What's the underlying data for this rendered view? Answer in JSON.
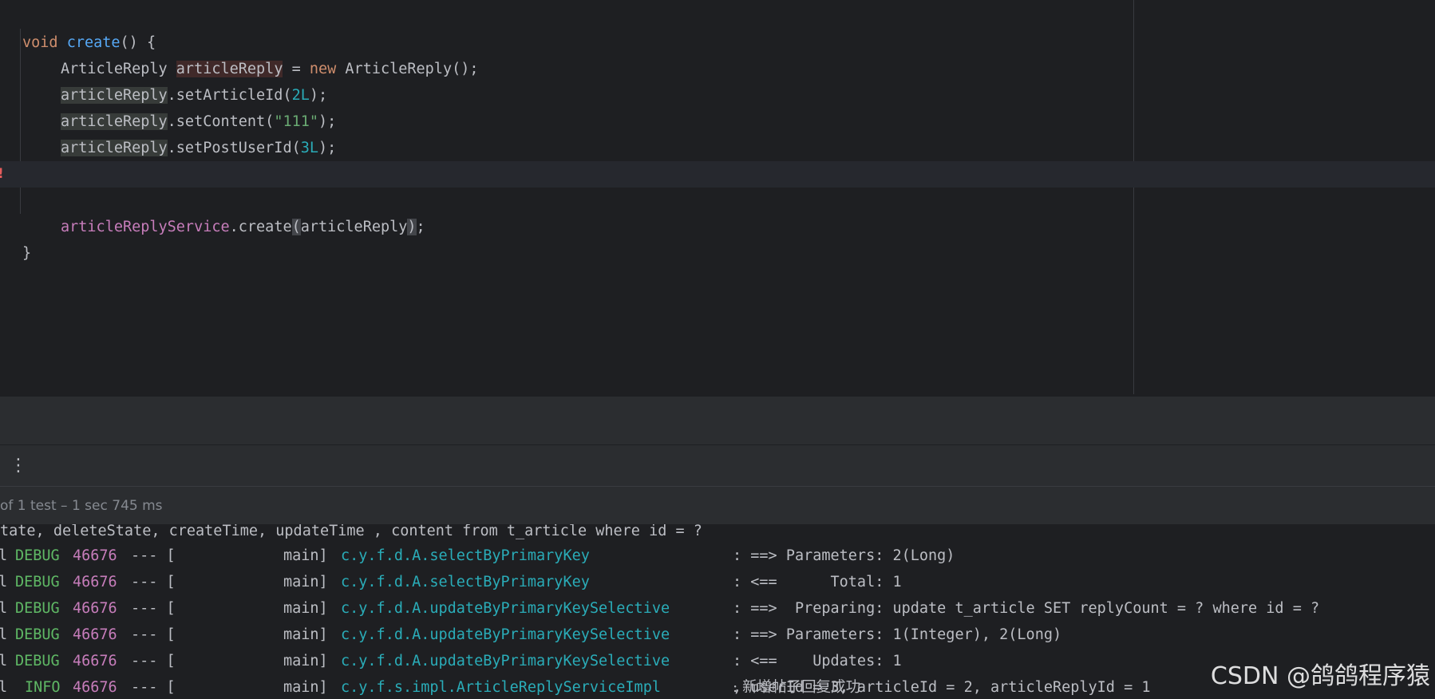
{
  "editor": {
    "lines": {
      "l0": {
        "kw_void": "void",
        "method_name": "create",
        "tail": "() {"
      },
      "l1": {
        "type": "ArticleReply",
        "var": "articleReply",
        "eq": " = ",
        "kw_new": "new",
        "ctor": " ArticleReply();"
      },
      "l2": {
        "var": "articleReply",
        "call": ".setArticleId(",
        "arg": "2L",
        "end": ");"
      },
      "l3": {
        "var": "articleReply",
        "call": ".setContent(",
        "arg": "\"111\"",
        "end": ");"
      },
      "l4": {
        "var": "articleReply",
        "call": ".setPostUserId(",
        "arg": "3L",
        "end": ");"
      },
      "l5": {
        "field": "articleReplyService",
        "call": ".create",
        "open": "(",
        "arg": "articleReply",
        "close": ")",
        "end": ";"
      },
      "l6": {
        "brace": "}"
      }
    },
    "gutter_icon": "error-bulb-icon",
    "gutter_glyph": "!"
  },
  "toolbar": {
    "more_icon": "more-vertical-icon",
    "more_glyph": "⋮"
  },
  "status": {
    "text": "of 1 test – 1 sec 745 ms"
  },
  "console": {
    "partial_line": "tate, deleteState, createTime, updateTime , content from t_article where id = ?",
    "lines": [
      {
        "prefix": "l",
        "level": "DEBUG",
        "pid": "46676",
        "sep": "--- [",
        "thread": "main]",
        "logger": "c.y.f.d.A.selectByPrimaryKey",
        "message": ": ==> Parameters: 2(Long)"
      },
      {
        "prefix": "l",
        "level": "DEBUG",
        "pid": "46676",
        "sep": "--- [",
        "thread": "main]",
        "logger": "c.y.f.d.A.selectByPrimaryKey",
        "message": ": <==      Total: 1"
      },
      {
        "prefix": "l",
        "level": "DEBUG",
        "pid": "46676",
        "sep": "--- [",
        "thread": "main]",
        "logger": "c.y.f.d.A.updateByPrimaryKeySelective",
        "message": ": ==>  Preparing: update t_article SET replyCount = ? where id = ?"
      },
      {
        "prefix": "l",
        "level": "DEBUG",
        "pid": "46676",
        "sep": "--- [",
        "thread": "main]",
        "logger": "c.y.f.d.A.updateByPrimaryKeySelective",
        "message": ": ==> Parameters: 1(Integer), 2(Long)"
      },
      {
        "prefix": "l",
        "level": "DEBUG",
        "pid": "46676",
        "sep": "--- [",
        "thread": "main]",
        "logger": "c.y.f.d.A.updateByPrimaryKeySelective",
        "message": ": <==    Updates: 1"
      },
      {
        "prefix": "l",
        "level": "INFO",
        "pid": "46676",
        "sep": "--- [",
        "thread": "main]",
        "logger": "c.y.f.s.impl.ArticleReplyServiceImpl",
        "message_cjk": ": 新增帖子回复成功",
        "message": ", userId = 3, articleId = 2, articleReplyId = 1"
      }
    ]
  },
  "watermark": "CSDN @鸽鸽程序猿",
  "colors": {
    "background": "#1e1f22",
    "keyword": "#cf8e6d",
    "method": "#56a8f5",
    "number": "#2aacb8",
    "string": "#6aab73",
    "field": "#c77dbb",
    "log_level": "#5fb865",
    "logger": "#2aacb8"
  }
}
